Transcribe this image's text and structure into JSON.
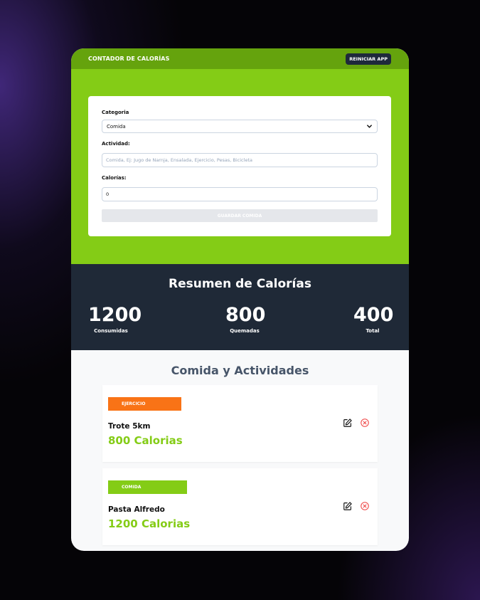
{
  "header": {
    "brand": "CONTADOR DE CALORÍAS",
    "reset_label": "REINICIAR APP"
  },
  "form": {
    "category_label": "Categoria",
    "category_value": "Comida",
    "activity_label": "Actividad:",
    "activity_placeholder": "Comida, Ej: Jugo de Narnja, Ensalada, Ejercicio, Pesas, Bicicleta",
    "calories_label": "Calorías:",
    "calories_value": "0",
    "submit_label": "GUARDAR COMIDA"
  },
  "summary": {
    "title": "Resumen de Calorías",
    "stats": [
      {
        "value": "1200",
        "label": "Consumidas"
      },
      {
        "value": "800",
        "label": "Quemadas"
      },
      {
        "value": "400",
        "label": "Total"
      }
    ]
  },
  "list": {
    "title": "Comida y Actividades",
    "items": [
      {
        "tag": "EJERCICIO",
        "tag_color": "#f97316",
        "name": "Trote 5km",
        "calories": "800 Calorias"
      },
      {
        "tag": "COMIDA",
        "tag_color": "#84cc16",
        "name": "Pasta Alfredo",
        "calories": "1200 Calorias"
      }
    ]
  },
  "colors": {
    "accent": "#84cc16",
    "accent_dark": "#65a30d",
    "dark": "#1f2937",
    "exercise": "#f97316",
    "delete": "#ef4444"
  }
}
